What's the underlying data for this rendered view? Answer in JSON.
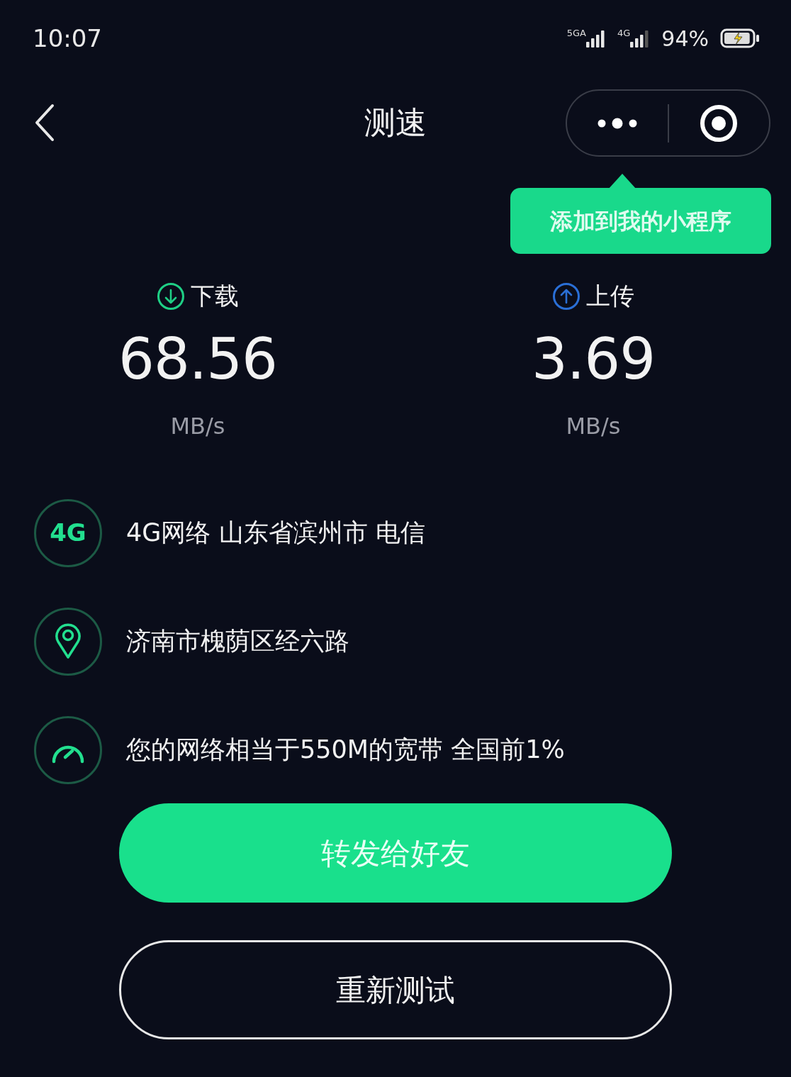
{
  "status_bar": {
    "time": "10:07",
    "signals": [
      {
        "label": "5GA",
        "kind": "full"
      },
      {
        "label": "4G",
        "kind": "partial"
      }
    ],
    "battery": "94%",
    "charging": true
  },
  "header": {
    "title": "测速"
  },
  "tooltip": {
    "text": "添加到我的小程序"
  },
  "metrics": [
    {
      "kind": "download",
      "label": "下载",
      "value": "68.56",
      "unit": "MB/s"
    },
    {
      "kind": "upload",
      "label": "上传",
      "value": "3.69",
      "unit": "MB/s"
    }
  ],
  "info": [
    {
      "kind": "network",
      "badge": "4G",
      "text": "4G网络 山东省滨州市 电信"
    },
    {
      "kind": "location",
      "text": "济南市槐荫区经六路"
    },
    {
      "kind": "speed",
      "text": "您的网络相当于550M的宽带 全国前1%"
    }
  ],
  "buttons": [
    {
      "kind": "primary",
      "label": "转发给好友"
    },
    {
      "kind": "outline",
      "label": "重新测试"
    }
  ]
}
